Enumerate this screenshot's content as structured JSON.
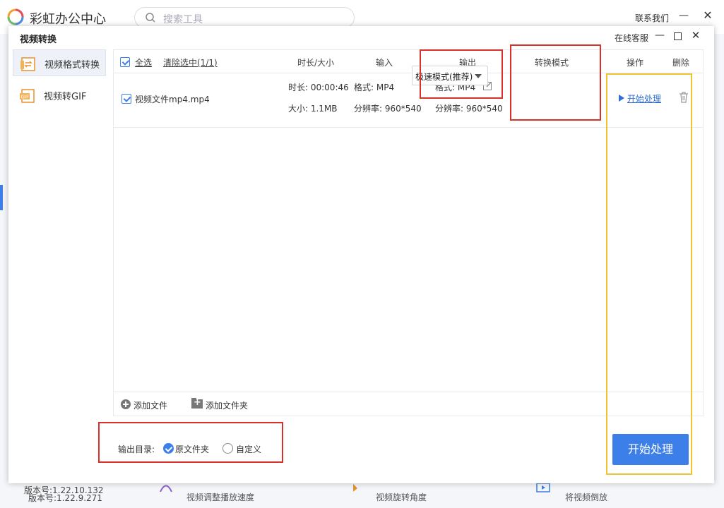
{
  "background": {
    "app_title": "彩虹办公中心",
    "search_placeholder": "搜索工具",
    "contact": "联系我们",
    "version": "版本号:1.22.9.271",
    "tools": [
      "视频调整播放速度",
      "视频旋转角度",
      "将视频倒放"
    ]
  },
  "dialog": {
    "title": "视频转换",
    "online_service": "在线客服",
    "sidebar": {
      "items": [
        {
          "label": "视频格式转换",
          "icon": "video-convert-icon"
        },
        {
          "label": "视频转GIF",
          "icon": "gif-icon"
        }
      ],
      "version": "版本号:1.22.10.132"
    },
    "table": {
      "headers": {
        "select_all": "全选",
        "clear_selected": "清除选中(1/1)",
        "duration_size": "时长/大小",
        "input": "输入",
        "output": "输出",
        "mode": "转换模式",
        "action": "操作",
        "delete": "删除"
      },
      "rows": [
        {
          "filename": "视频文件mp4.mp4",
          "duration": "时长: 00:00:46",
          "size": "大小: 1.1MB",
          "input_format": "格式: MP4",
          "input_resolution": "分辨率: 960*540",
          "output_format": "格式: MP4",
          "output_resolution": "分辨率: 960*540",
          "mode": "极速模式(推荐)",
          "action": "开始处理"
        }
      ]
    },
    "footer": {
      "add_file": "添加文件",
      "add_folder": "添加文件夹"
    },
    "output_dir": {
      "label": "输出目录:",
      "options": [
        "原文件夹",
        "自定义"
      ],
      "selected": "原文件夹"
    },
    "start_button": "开始处理"
  },
  "colors": {
    "accent": "#3d7fe8",
    "annotation_red": "#d9302c",
    "annotation_yellow": "#f2c230"
  }
}
